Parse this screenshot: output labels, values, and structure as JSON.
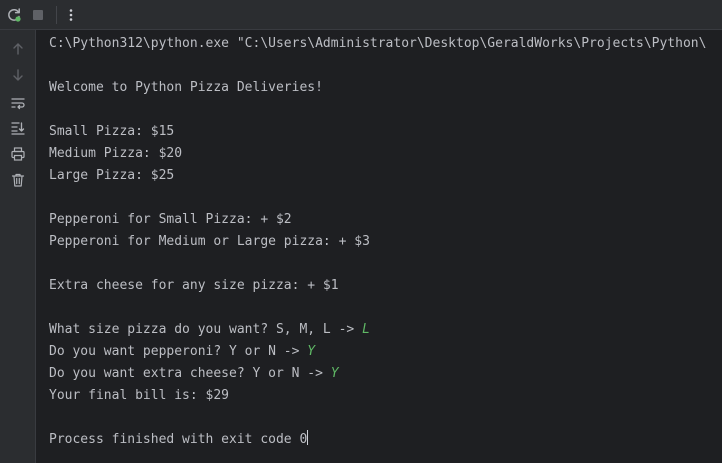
{
  "toolbar": {
    "icons": [
      "rerun-icon",
      "stop-icon",
      "more-options-icon"
    ]
  },
  "gutter": {
    "icons": [
      "scroll-up-icon",
      "scroll-down-icon",
      "soft-wrap-icon",
      "scroll-to-end-icon",
      "print-icon",
      "clear-all-icon"
    ]
  },
  "console": {
    "command": "C:\\Python312\\python.exe \"C:\\Users\\Administrator\\Desktop\\GeraldWorks\\Projects\\Python\\",
    "welcome": "Welcome to Python Pizza Deliveries!",
    "small_price": "Small Pizza: $15",
    "medium_price": "Medium Pizza: $20",
    "large_price": "Large Pizza: $25",
    "pepperoni_small": "Pepperoni for Small Pizza: + $2",
    "pepperoni_medium_large": "Pepperoni for Medium or Large pizza: + $3",
    "extra_cheese": "Extra cheese for any size pizza: + $1",
    "size_prompt": "What size pizza do you want? S, M, L -> ",
    "size_input": "L",
    "pepperoni_prompt": "Do you want pepperoni? Y or N -> ",
    "pepperoni_input": "Y",
    "cheese_prompt": "Do you want extra cheese? Y or N -> ",
    "cheese_input": "Y",
    "final_bill": "Your final bill is: $29",
    "exit_message": "Process finished with exit code 0"
  },
  "colors": {
    "background": "#1e1f22",
    "panel": "#2b2d30",
    "text": "#bcbec4",
    "user_input": "#5fb865",
    "rerun_icon": "#5fb865"
  }
}
